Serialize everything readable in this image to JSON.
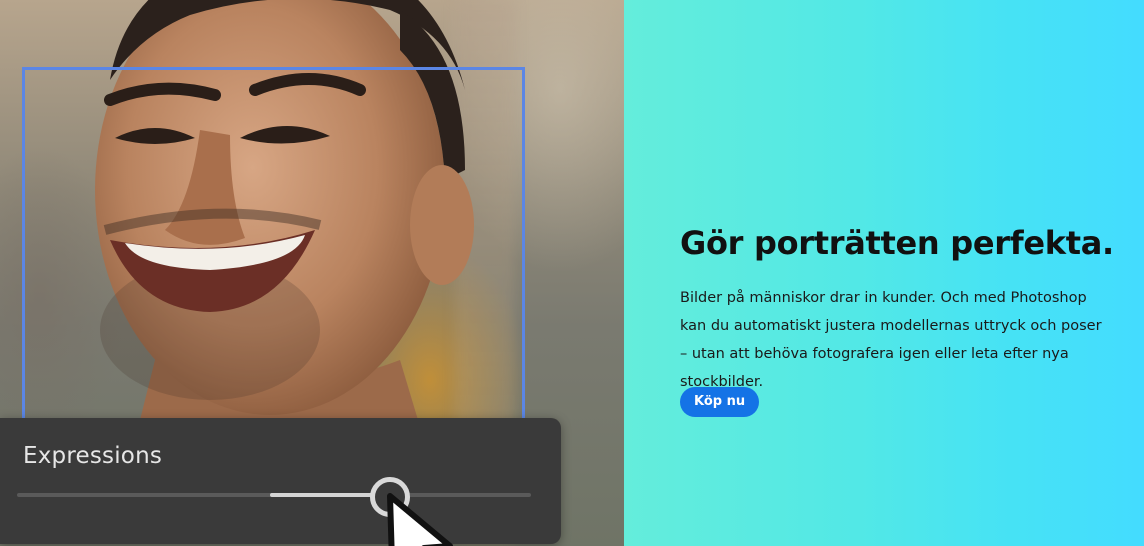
{
  "panel": {
    "label": "Expressions",
    "slider_value_fraction": 0.72
  },
  "promo": {
    "title": "Gör porträtten perfekta.",
    "body": "Bilder på människor drar in kunder. Och med Photoshop kan du automatiskt justera modellernas uttryck och poser – utan att behöva fotografera igen eller leta efter nya stockbilder.",
    "button_label": "Köp nu"
  },
  "colors": {
    "detection_box": "#5b86e5",
    "panel_background": "#3a3a3a",
    "button": "#1473e6",
    "promo_gradient_start": "#64eddb",
    "promo_gradient_end": "#44dcff"
  },
  "icons": {
    "cursor": "pointer-cursor-icon"
  }
}
